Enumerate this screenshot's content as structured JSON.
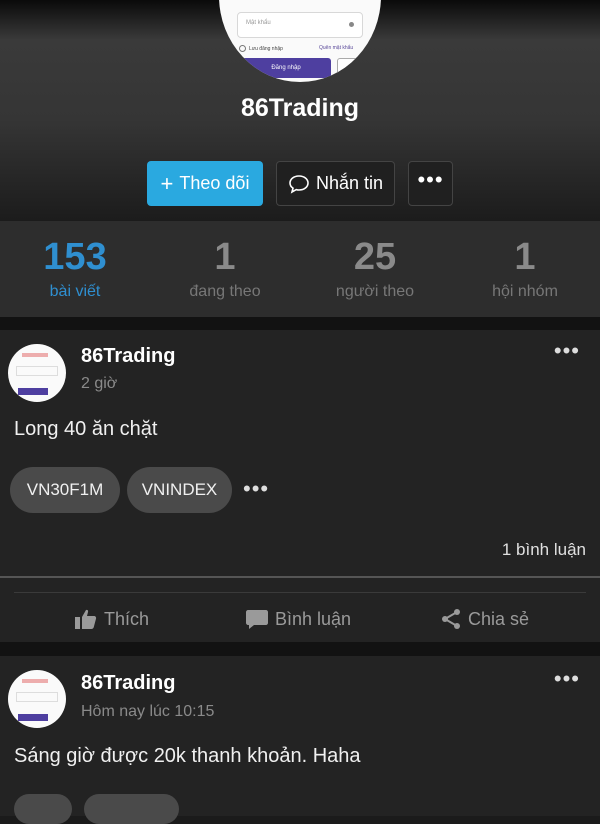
{
  "profile": {
    "name": "86Trading",
    "avatar_preview": {
      "field_placeholder": "Mật khẩu",
      "remember": "Lưu đăng nhập",
      "forgot": "Quên mật khẩu",
      "login": "Đăng nhập"
    }
  },
  "actions": {
    "follow_label": "Theo dõi",
    "message_label": "Nhắn tin",
    "more_label": "•••"
  },
  "stats": [
    {
      "value": "153",
      "label": "bài viết",
      "active": true
    },
    {
      "value": "1",
      "label": "đang theo"
    },
    {
      "value": "25",
      "label": "người theo"
    },
    {
      "value": "1",
      "label": "hội nhóm"
    }
  ],
  "posts": [
    {
      "author": "86Trading",
      "time": "2 giờ",
      "text": "Long 40 ăn chặt",
      "tags": [
        "VN30F1M",
        "VNINDEX"
      ],
      "more": "•••",
      "comments": "1 bình luận",
      "like_label": "Thích",
      "comment_label": "Bình luận",
      "share_label": "Chia sẻ"
    },
    {
      "author": "86Trading",
      "time": "Hôm nay lúc 10:15",
      "text": "Sáng giờ được 20k thanh khoản. Haha",
      "more": "•••"
    }
  ],
  "colors": {
    "accent": "#2aa9e0",
    "active_stat": "#2f8fd0",
    "card_bg": "#232323"
  }
}
